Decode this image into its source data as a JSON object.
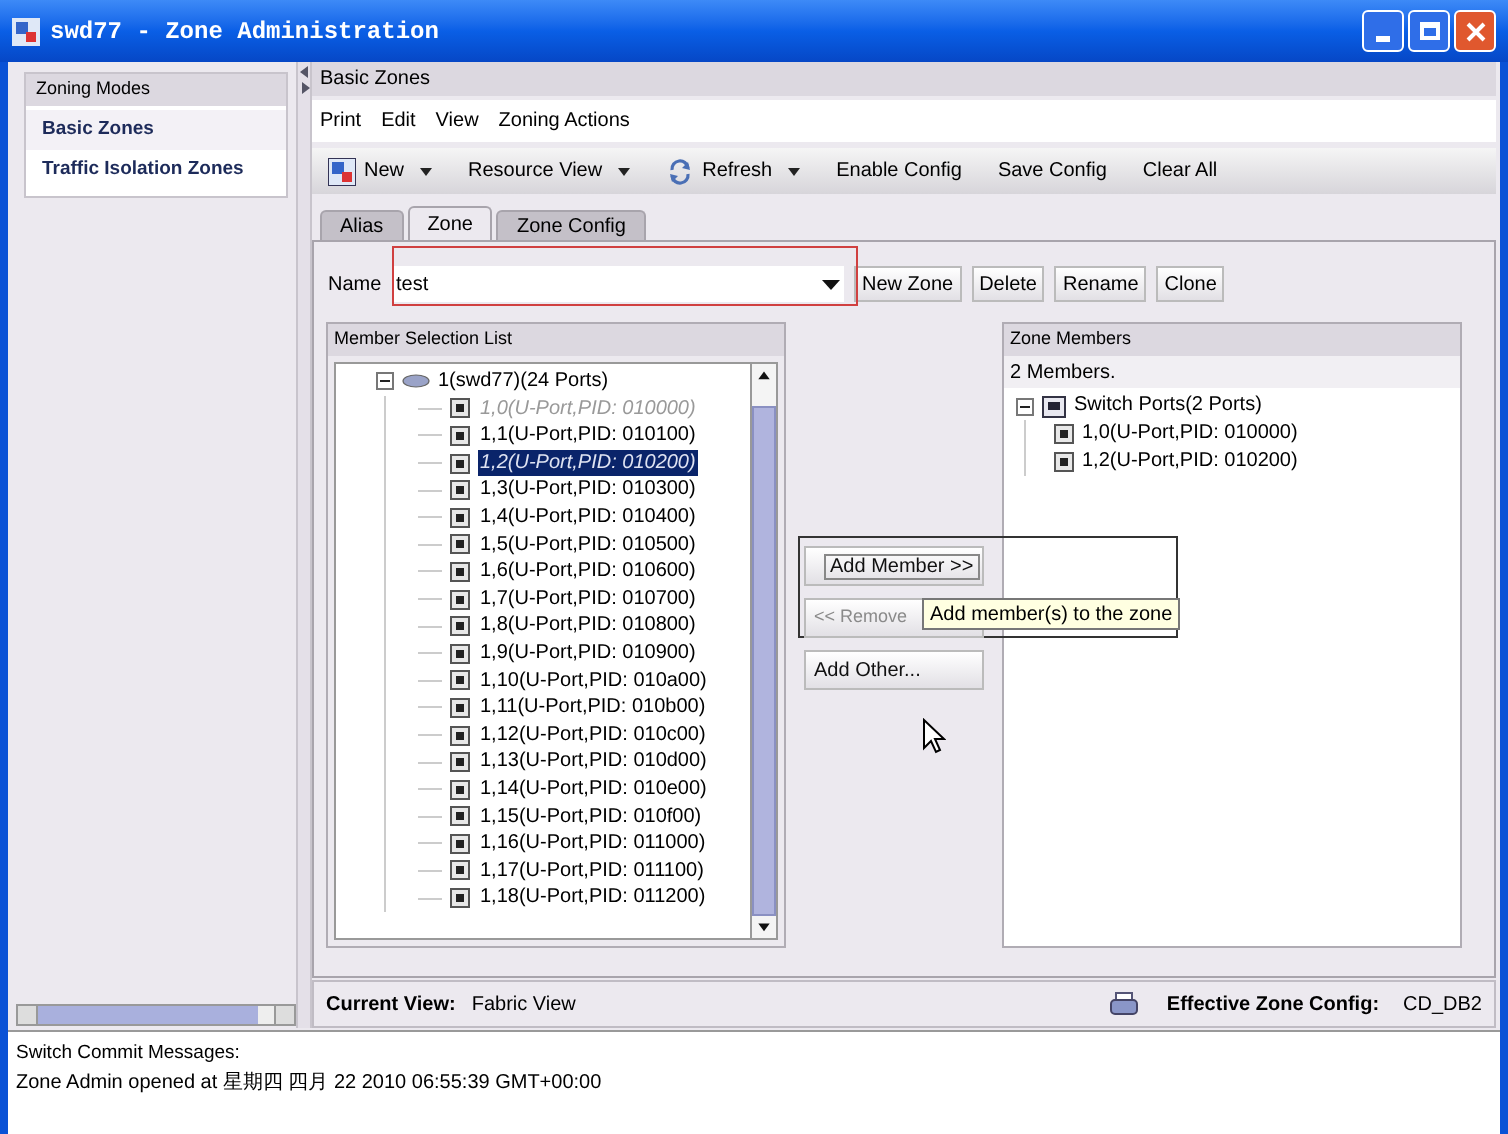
{
  "window": {
    "title": "swd77 - Zone Administration"
  },
  "sidebar": {
    "title": "Zoning Modes",
    "items": [
      {
        "label": "Basic Zones",
        "selected": true
      },
      {
        "label": "Traffic Isolation Zones",
        "selected": false
      }
    ]
  },
  "panel_title": "Basic Zones",
  "menu": [
    "Print",
    "Edit",
    "View",
    "Zoning Actions"
  ],
  "toolbar": [
    {
      "label": "New",
      "kind": "icon-dropdown"
    },
    {
      "label": "Resource View",
      "kind": "dropdown"
    },
    {
      "label": "Refresh",
      "kind": "refresh-dropdown"
    },
    {
      "label": "Enable Config",
      "kind": "plain"
    },
    {
      "label": "Save Config",
      "kind": "plain"
    },
    {
      "label": "Clear All",
      "kind": "plain"
    }
  ],
  "tabs": [
    {
      "label": "Alias",
      "selected": false
    },
    {
      "label": "Zone",
      "selected": true
    },
    {
      "label": "Zone Config",
      "selected": false
    }
  ],
  "name_field": {
    "label": "Name",
    "value": "test"
  },
  "zone_buttons": [
    "New Zone",
    "Delete",
    "Rename",
    "Clone"
  ],
  "member_list": {
    "title": "Member Selection List",
    "root": {
      "label": "1(swd77)(24 Ports)",
      "expanded": true,
      "children": [
        {
          "label": "1,0(U-Port,PID: 010000)",
          "in_zone": true,
          "selected": false
        },
        {
          "label": "1,1(U-Port,PID: 010100)",
          "in_zone": false,
          "selected": false
        },
        {
          "label": "1,2(U-Port,PID: 010200)",
          "in_zone": true,
          "selected": true
        },
        {
          "label": "1,3(U-Port,PID: 010300)",
          "in_zone": false,
          "selected": false
        },
        {
          "label": "1,4(U-Port,PID: 010400)",
          "in_zone": false,
          "selected": false
        },
        {
          "label": "1,5(U-Port,PID: 010500)",
          "in_zone": false,
          "selected": false
        },
        {
          "label": "1,6(U-Port,PID: 010600)",
          "in_zone": false,
          "selected": false
        },
        {
          "label": "1,7(U-Port,PID: 010700)",
          "in_zone": false,
          "selected": false
        },
        {
          "label": "1,8(U-Port,PID: 010800)",
          "in_zone": false,
          "selected": false
        },
        {
          "label": "1,9(U-Port,PID: 010900)",
          "in_zone": false,
          "selected": false
        },
        {
          "label": "1,10(U-Port,PID: 010a00)",
          "in_zone": false,
          "selected": false
        },
        {
          "label": "1,11(U-Port,PID: 010b00)",
          "in_zone": false,
          "selected": false
        },
        {
          "label": "1,12(U-Port,PID: 010c00)",
          "in_zone": false,
          "selected": false
        },
        {
          "label": "1,13(U-Port,PID: 010d00)",
          "in_zone": false,
          "selected": false
        },
        {
          "label": "1,14(U-Port,PID: 010e00)",
          "in_zone": false,
          "selected": false
        },
        {
          "label": "1,15(U-Port,PID: 010f00)",
          "in_zone": false,
          "selected": false
        },
        {
          "label": "1,16(U-Port,PID: 011000)",
          "in_zone": false,
          "selected": false
        },
        {
          "label": "1,17(U-Port,PID: 011100)",
          "in_zone": false,
          "selected": false
        },
        {
          "label": "1,18(U-Port,PID: 011200)",
          "in_zone": false,
          "selected": false
        }
      ]
    }
  },
  "actions": [
    {
      "label": "Add Member >>",
      "disabled": false
    },
    {
      "label": "<< Remove",
      "disabled": true
    },
    {
      "label": "Add Other...",
      "disabled": false
    }
  ],
  "tooltip": "Add member(s) to the zone",
  "zone_members": {
    "title": "Zone Members",
    "count": "2 Members.",
    "root": {
      "label": "Switch Ports(2 Ports)",
      "expanded": true,
      "children": [
        {
          "label": "1,0(U-Port,PID: 010000)"
        },
        {
          "label": "1,2(U-Port,PID: 010200)"
        }
      ]
    }
  },
  "status_bar": {
    "current_view_label": "Current View:",
    "current_view": "Fabric View",
    "config_label": "Effective Zone Config:",
    "config": "CD_DB2"
  },
  "messages": {
    "title": "Switch Commit Messages:",
    "lines": [
      "Zone Admin opened at 星期四 四月 22 2010 06:55:39 GMT+00:00"
    ]
  }
}
